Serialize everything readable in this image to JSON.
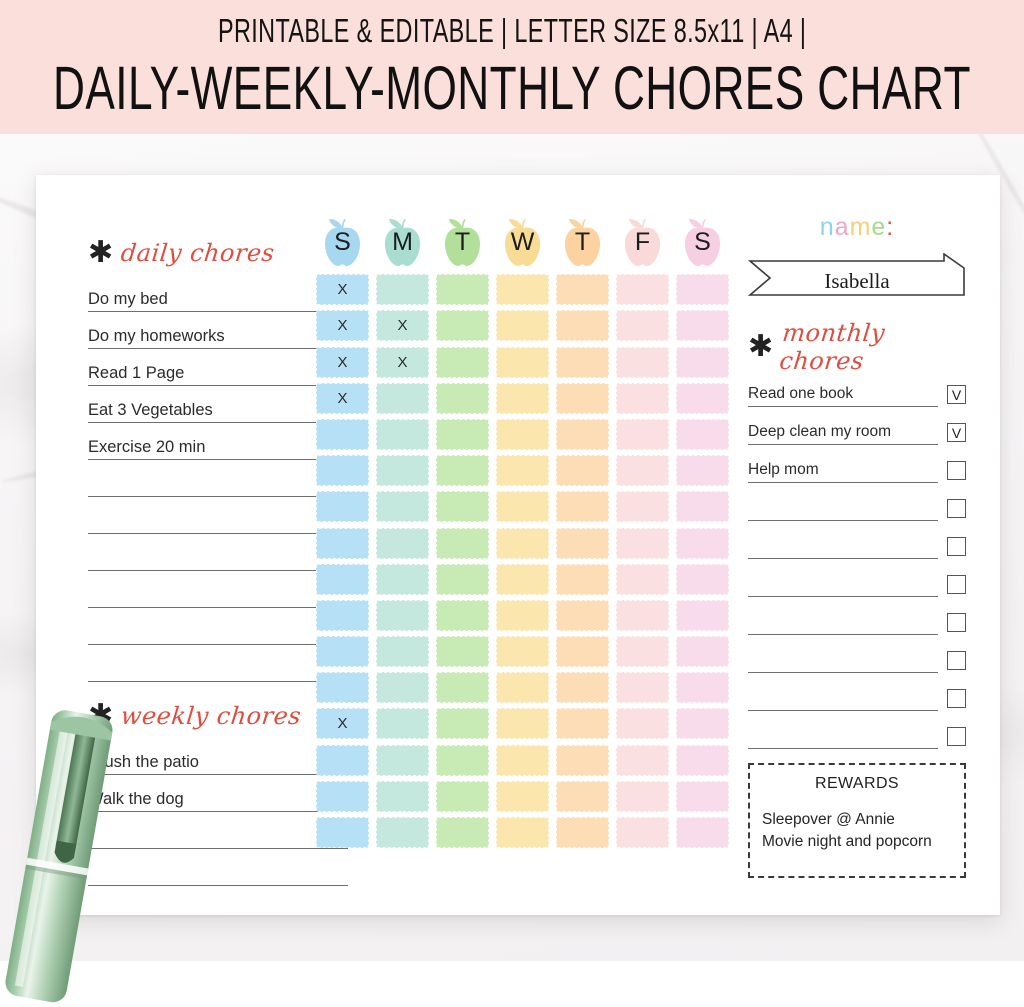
{
  "banner": {
    "subtitle": "PRINTABLE & EDITABLE | LETTER SIZE 8.5x11 | A4 |",
    "title": "DAILY-WEEKLY-MONTHLY CHORES CHART",
    "bg_color": "#fadfda"
  },
  "daily": {
    "heading": "daily chores",
    "star": "✱",
    "items": [
      "Do my bed",
      "Do my homeworks",
      "Read 1 Page",
      "Eat 3 Vegetables",
      "Exercise 20 min",
      "",
      "",
      "",
      "",
      "",
      ""
    ]
  },
  "weekly": {
    "heading": "weekly chores",
    "star": "✱",
    "items": [
      "Brush the patio",
      "Walk the dog",
      "",
      ""
    ]
  },
  "name": {
    "label_letters": [
      {
        "ch": "n",
        "color": "#8fd3e8"
      },
      {
        "ch": "a",
        "color": "#f2a7bd"
      },
      {
        "ch": "m",
        "color": "#f6cf7d"
      },
      {
        "ch": "e",
        "color": "#a8d98b"
      },
      {
        "ch": ":",
        "color": "#e24c3f"
      }
    ],
    "value": "Isabella",
    "placeholder": "Name"
  },
  "monthly": {
    "heading": "monthly chores",
    "star": "✱",
    "check_mark": "V",
    "items": [
      {
        "text": "Read one book",
        "checked": true
      },
      {
        "text": "Deep clean my room",
        "checked": true
      },
      {
        "text": "Help mom",
        "checked": false
      },
      {
        "text": "",
        "checked": false
      },
      {
        "text": "",
        "checked": false
      },
      {
        "text": "",
        "checked": false
      },
      {
        "text": "",
        "checked": false
      },
      {
        "text": "",
        "checked": false
      },
      {
        "text": "",
        "checked": false
      },
      {
        "text": "",
        "checked": false
      }
    ]
  },
  "rewards": {
    "title": "REWARDS",
    "items": [
      "Sleepover @ Annie",
      "Movie night and popcorn"
    ]
  },
  "chart_data": {
    "type": "table",
    "title": "Daily-Weekly-Monthly Chores Chart",
    "columns": [
      "S",
      "M",
      "T",
      "W",
      "T",
      "F",
      "S"
    ],
    "column_colors": [
      "#b6e0f5",
      "#c4e8dd",
      "#c8eab5",
      "#fbe6ad",
      "#fcddb5",
      "#fae0e0",
      "#f9dceb"
    ],
    "header_apple_colors": [
      "#a8d8f0",
      "#a9ddd0",
      "#b2e09a",
      "#f8dc96",
      "#fbd2a0",
      "#fad9d9",
      "#f6cfe2"
    ],
    "rows": 16,
    "mark": "X",
    "marks": [
      {
        "row": 1,
        "col": 1
      },
      {
        "row": 2,
        "col": 1
      },
      {
        "row": 2,
        "col": 2
      },
      {
        "row": 3,
        "col": 1
      },
      {
        "row": 3,
        "col": 2
      },
      {
        "row": 4,
        "col": 1
      },
      {
        "row": 13,
        "col": 1
      }
    ]
  },
  "colors": {
    "accent_red": "#e24c3f",
    "banner_pink": "#fadfda",
    "rule_gray": "#6e6e6e"
  }
}
